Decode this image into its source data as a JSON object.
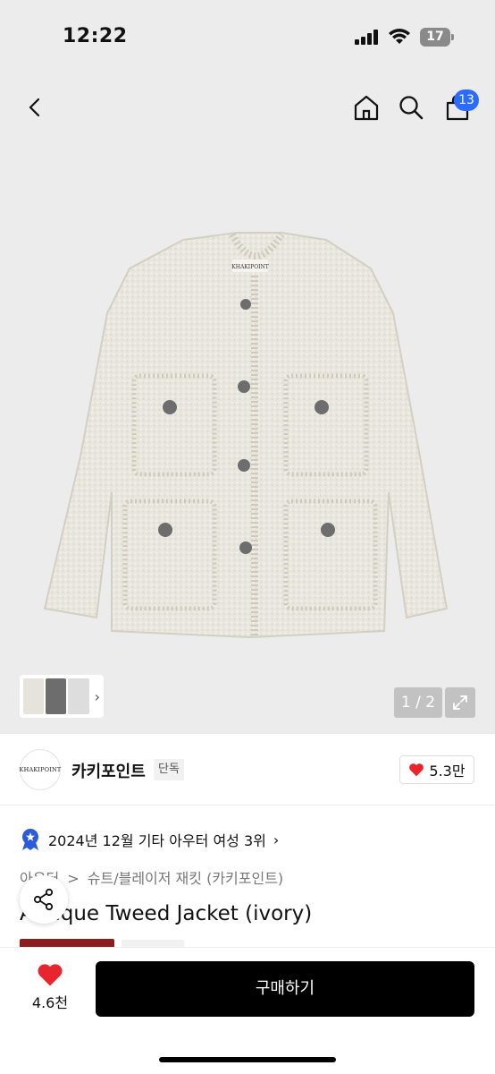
{
  "status_bar": {
    "time": "12:22",
    "battery": "17"
  },
  "nav": {
    "cart_count": "13"
  },
  "gallery": {
    "page_indicator": "1 / 2",
    "logo_text": "KHAKIPOINT"
  },
  "brand": {
    "name": "카키포인트",
    "tag": "단독",
    "likes": "5.3만",
    "logo_text": "KHAKIPOINT"
  },
  "ranking": {
    "text": "2024년 12월 기타 아우터 여성 3위"
  },
  "category": {
    "main": "아우터",
    "sep": ">",
    "sub": "슈트/블레이저 재킷 (카키포인트)"
  },
  "product": {
    "title": "Antique Tweed Jacket (ivory)"
  },
  "bottom": {
    "wish_count": "4.6천",
    "buy_label": "구매하기"
  },
  "colors": {
    "accent": "#2b6bff",
    "heart": "#e8252e",
    "buy": "#000000",
    "badge_rank": "#2b5bdc"
  },
  "icons": [
    "back-icon",
    "home-icon",
    "search-icon",
    "cart-icon",
    "expand-icon",
    "heart-icon",
    "share-icon",
    "rank-badge-icon"
  ]
}
